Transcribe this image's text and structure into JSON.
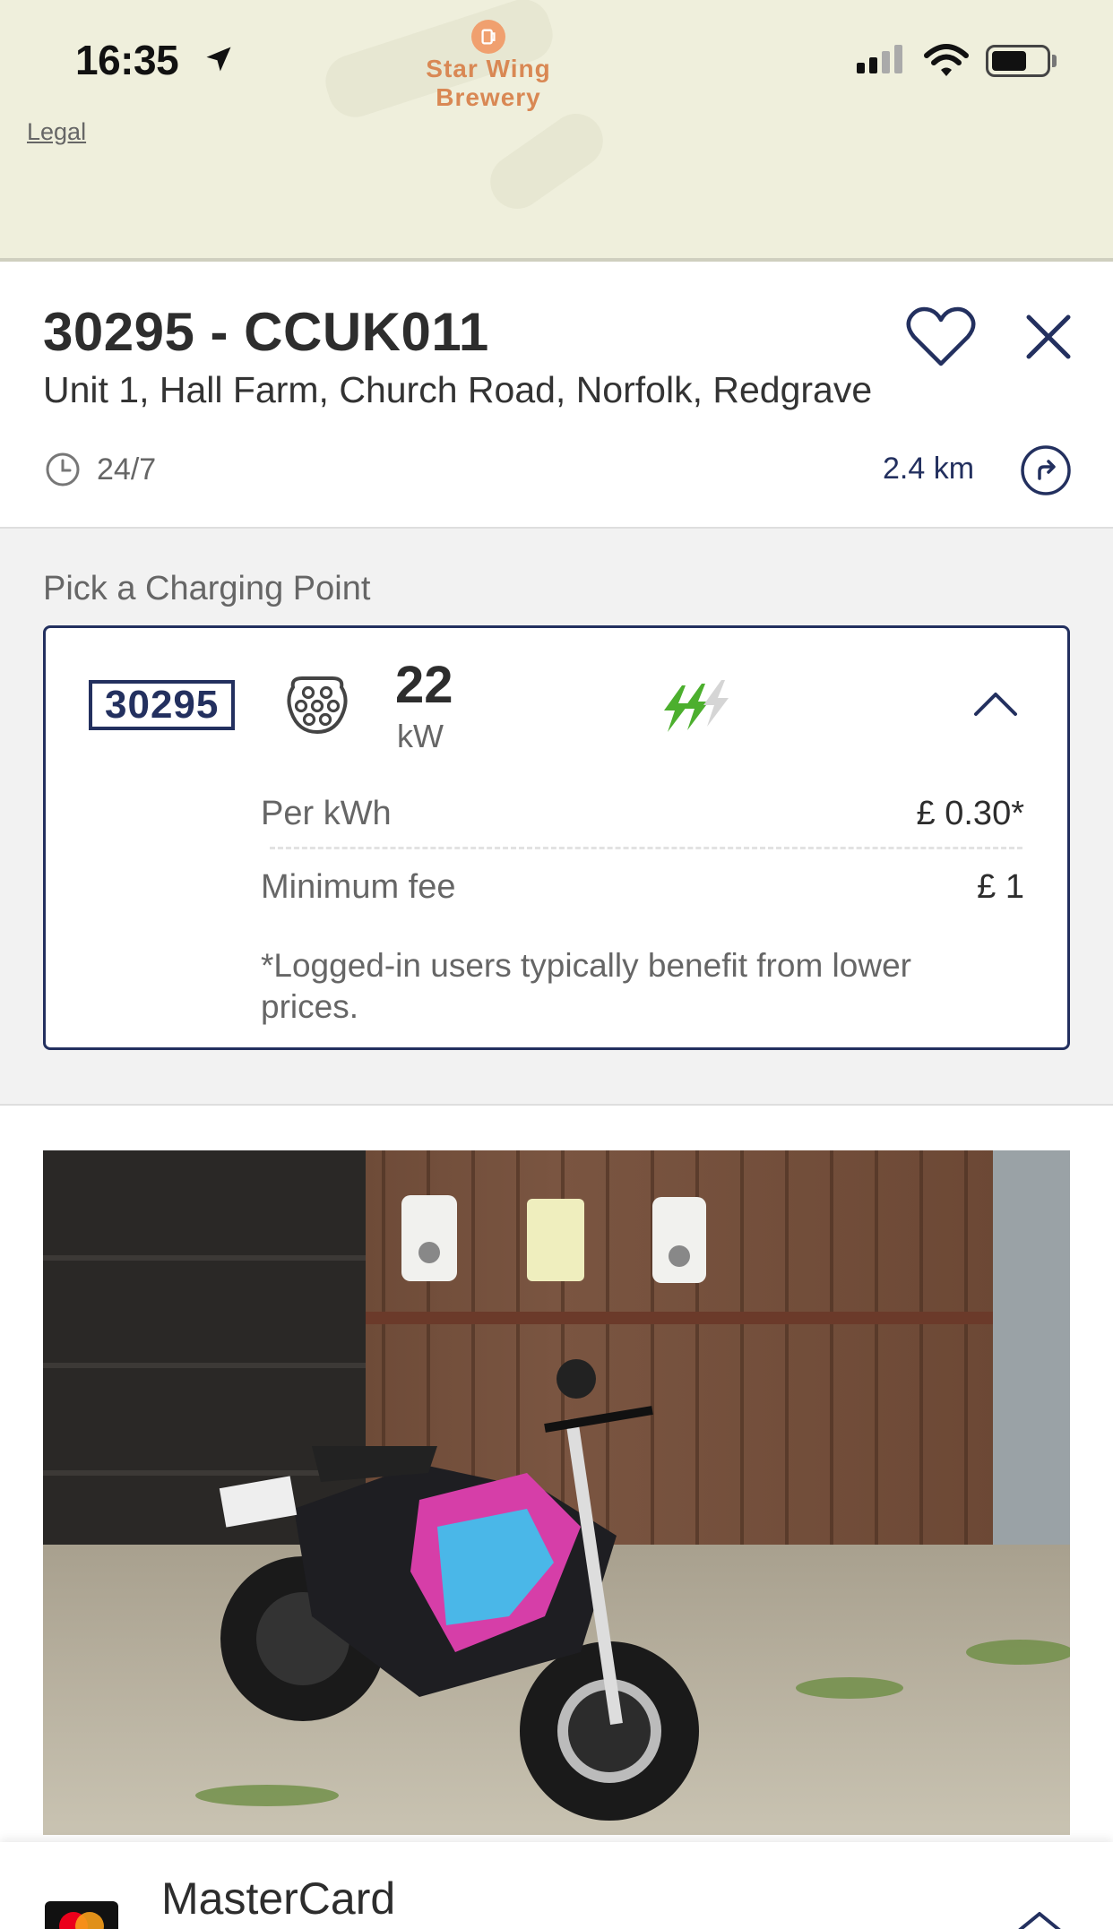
{
  "status_bar": {
    "time": "16:35"
  },
  "map": {
    "poi_name_line1": "Star Wing",
    "poi_name_line2": "Brewery",
    "legal_label": "Legal"
  },
  "station": {
    "title": "30295 - CCUK011",
    "address": "Unit 1, Hall Farm, Church Road, Norfolk, Redgrave",
    "hours": "24/7",
    "distance": "2.4 km"
  },
  "charging": {
    "section_label": "Pick a Charging Point",
    "point_id": "30295",
    "power_value": "22",
    "power_unit": "kW",
    "price_per_kwh_label": "Per kWh",
    "price_per_kwh_value": "£ 0.30*",
    "minimum_fee_label": "Minimum fee",
    "minimum_fee_value": "£ 1",
    "note": "*Logged-in users typically benefit from lower prices."
  },
  "payment": {
    "card_name": "MasterCard"
  },
  "colors": {
    "accent": "#23305f",
    "speed_green": "#4caf2e",
    "map_bg": "#efefdc",
    "poi": "#d98854"
  }
}
